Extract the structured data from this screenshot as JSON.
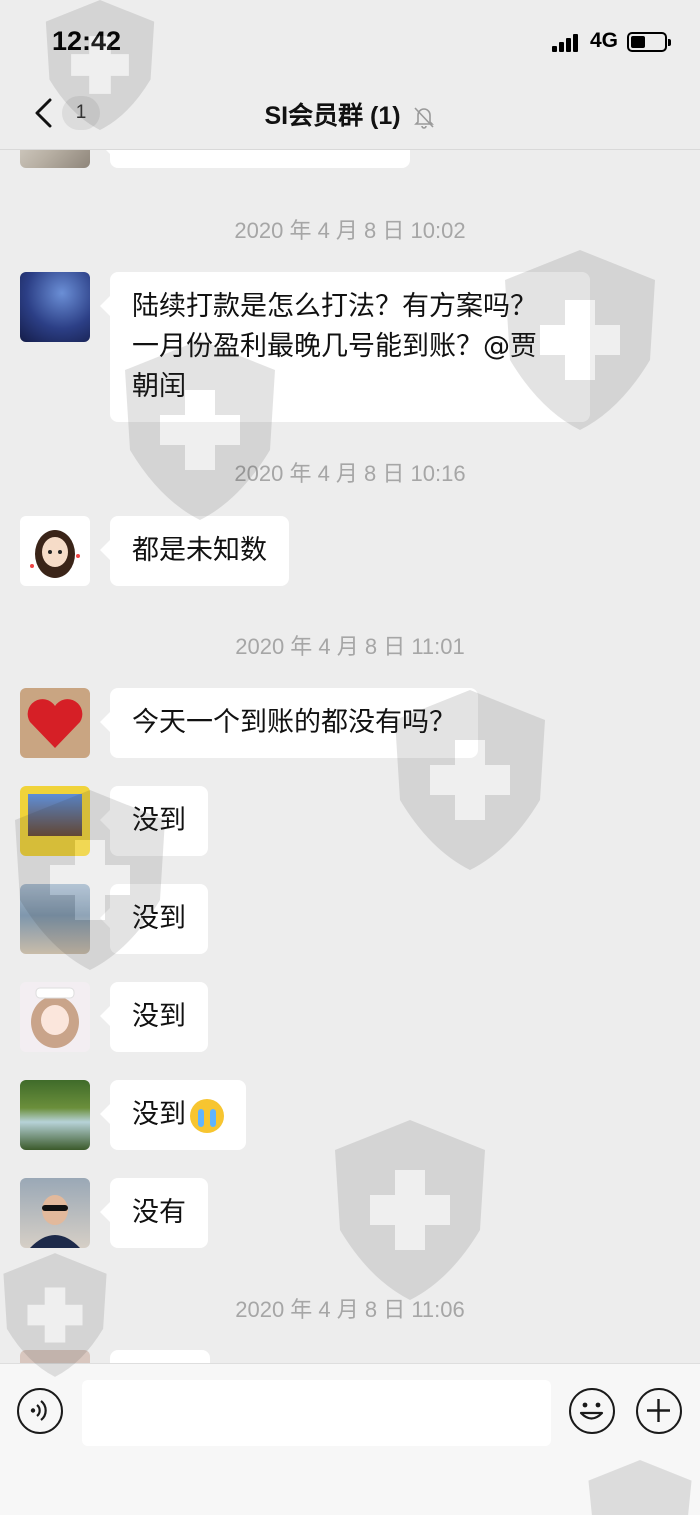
{
  "status_bar": {
    "time": "12:42",
    "network": "4G"
  },
  "nav": {
    "back_badge": "1",
    "title": "SI会员群 (1)",
    "mute_icon": "bell-slash-icon"
  },
  "messages": [
    {
      "type": "timestamp",
      "text": "2020 年 4 月 8 日 10:02"
    },
    {
      "type": "message",
      "avatar": "night-landscape",
      "lines": [
        "陆续打款是怎么打法？有方案吗？",
        "一月份盈利最晚几号能到账？@贾",
        "朝闰"
      ]
    },
    {
      "type": "timestamp",
      "text": "2020 年 4 月 8 日 10:16"
    },
    {
      "type": "message",
      "avatar": "cartoon-girl",
      "lines": [
        "都是未知数"
      ]
    },
    {
      "type": "timestamp",
      "text": "2020 年 4 月 8 日 11:01"
    },
    {
      "type": "message",
      "avatar": "red-heart",
      "lines": [
        "今天一个到账的都没有吗？"
      ]
    },
    {
      "type": "message",
      "avatar": "yellow-frame-photo",
      "lines": [
        "没到"
      ]
    },
    {
      "type": "message",
      "avatar": "beach-photo",
      "lines": [
        "没到"
      ]
    },
    {
      "type": "message",
      "avatar": "anime-girl",
      "lines": [
        "没到"
      ]
    },
    {
      "type": "message",
      "avatar": "waterfall",
      "lines": [
        "没到"
      ],
      "emoji": "crying-face-emoji"
    },
    {
      "type": "message",
      "avatar": "man-sunglasses",
      "lines": [
        "没有"
      ]
    },
    {
      "type": "timestamp",
      "text": "2020 年 4 月 8 日 11:06"
    }
  ],
  "colors": {
    "background": "#ededed",
    "bubble": "#ffffff",
    "timestamp": "#a6a6a6"
  }
}
